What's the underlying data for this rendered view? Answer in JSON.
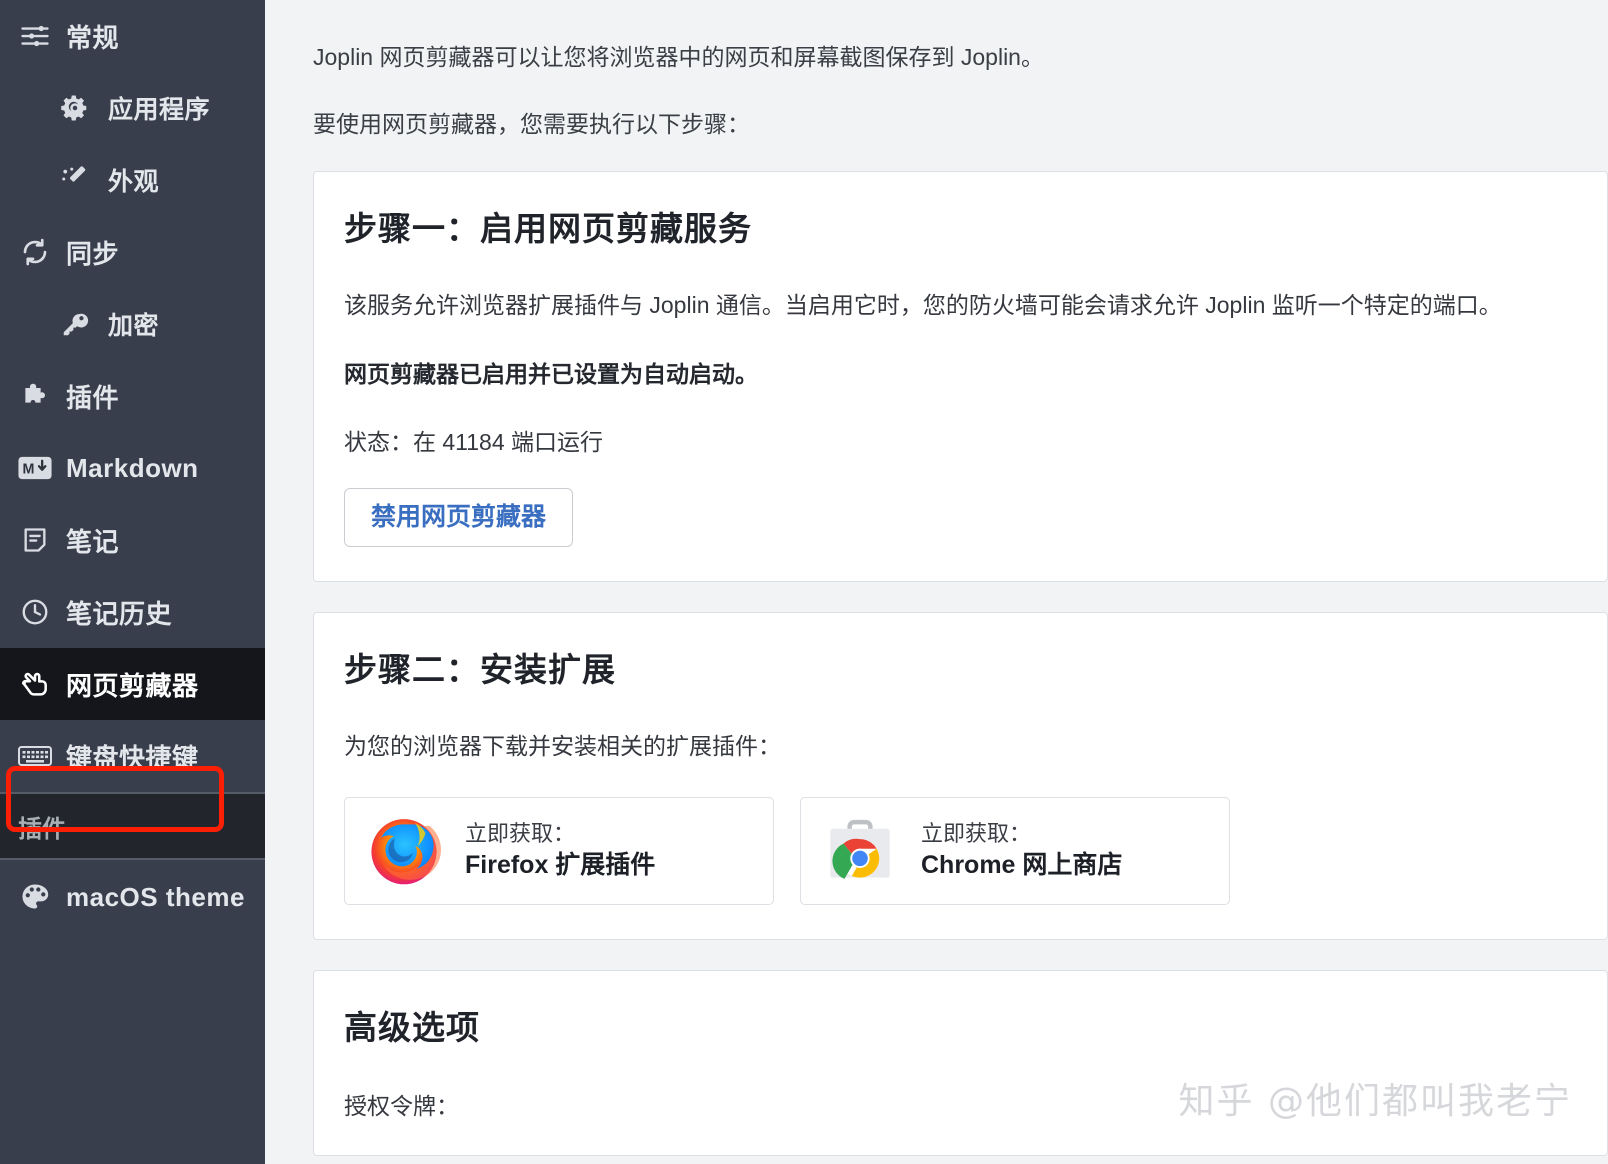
{
  "sidebar": {
    "items": [
      {
        "label": "常规",
        "icon": "sliders-icon",
        "indent": false,
        "selected": false
      },
      {
        "label": "应用程序",
        "icon": "gear-icon",
        "indent": true,
        "selected": false
      },
      {
        "label": "外观",
        "icon": "wand-icon",
        "indent": true,
        "selected": false
      },
      {
        "label": "同步",
        "icon": "sync-icon",
        "indent": false,
        "selected": false
      },
      {
        "label": "加密",
        "icon": "key-icon",
        "indent": true,
        "selected": false
      },
      {
        "label": "插件",
        "icon": "puzzle-icon",
        "indent": false,
        "selected": false
      },
      {
        "label": "Markdown",
        "icon": "markdown-icon",
        "indent": false,
        "selected": false
      },
      {
        "label": "笔记",
        "icon": "note-icon",
        "indent": false,
        "selected": false
      },
      {
        "label": "笔记历史",
        "icon": "clock-icon",
        "indent": false,
        "selected": false
      },
      {
        "label": "网页剪藏器",
        "icon": "clipper-icon",
        "indent": false,
        "selected": true
      },
      {
        "label": "键盘快捷键",
        "icon": "keyboard-icon",
        "indent": false,
        "selected": false
      }
    ],
    "section_header": "插件",
    "plugin_items": [
      {
        "label": "macOS theme",
        "icon": "palette-icon"
      }
    ],
    "colors": {
      "background": "#393e4c",
      "selected_background": "#14161b",
      "section_background": "#22252c",
      "annotation": "#fa1f05"
    }
  },
  "main": {
    "intro": [
      "Joplin 网页剪藏器可以让您将浏览器中的网页和屏幕截图保存到 Joplin。",
      "要使用网页剪藏器，您需要执行以下步骤："
    ],
    "step_one": {
      "title": "步骤一：启用网页剪藏服务",
      "description": "该服务允许浏览器扩展插件与 Joplin 通信。当启用它时，您的防火墙可能会请求允许 Joplin 监听一个特定的端口。",
      "status_line": "网页剪藏器已启用并已设置为自动启动。",
      "port_status": "状态：在 41184 端口运行",
      "port": "41184",
      "disable_button": "禁用网页剪藏器"
    },
    "step_two": {
      "title": "步骤二：安装扩展",
      "description": "为您的浏览器下载并安装相关的扩展插件：",
      "extensions": [
        {
          "get_label": "立即获取：",
          "name": "Firefox 扩展插件",
          "icon": "firefox-logo"
        },
        {
          "get_label": "立即获取：",
          "name": "Chrome 网上商店",
          "icon": "chrome-web-store-logo"
        }
      ]
    },
    "advanced": {
      "title": "高级选项",
      "token_label": "授权令牌："
    }
  },
  "watermark": "知乎 @他们都叫我老宁"
}
